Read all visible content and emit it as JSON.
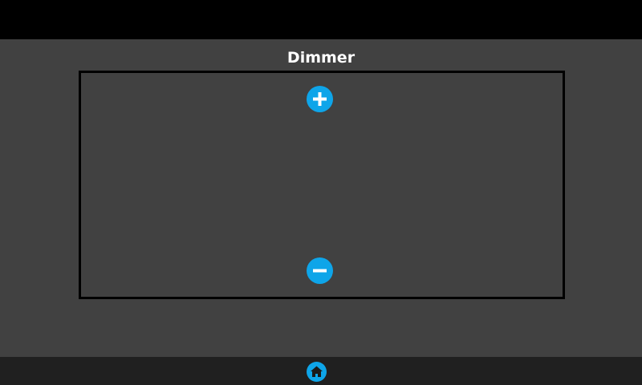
{
  "screen": {
    "title": "Dimmer"
  },
  "controls": {
    "increase_icon": "plus-icon",
    "decrease_icon": "minus-icon"
  },
  "nav": {
    "home_icon": "home-icon"
  },
  "colors": {
    "accent": "#0ea5e9",
    "background": "#414141",
    "top_bar": "#000000",
    "bottom_bar": "#202020",
    "panel_border": "#000000",
    "title_text": "#ffffff"
  }
}
